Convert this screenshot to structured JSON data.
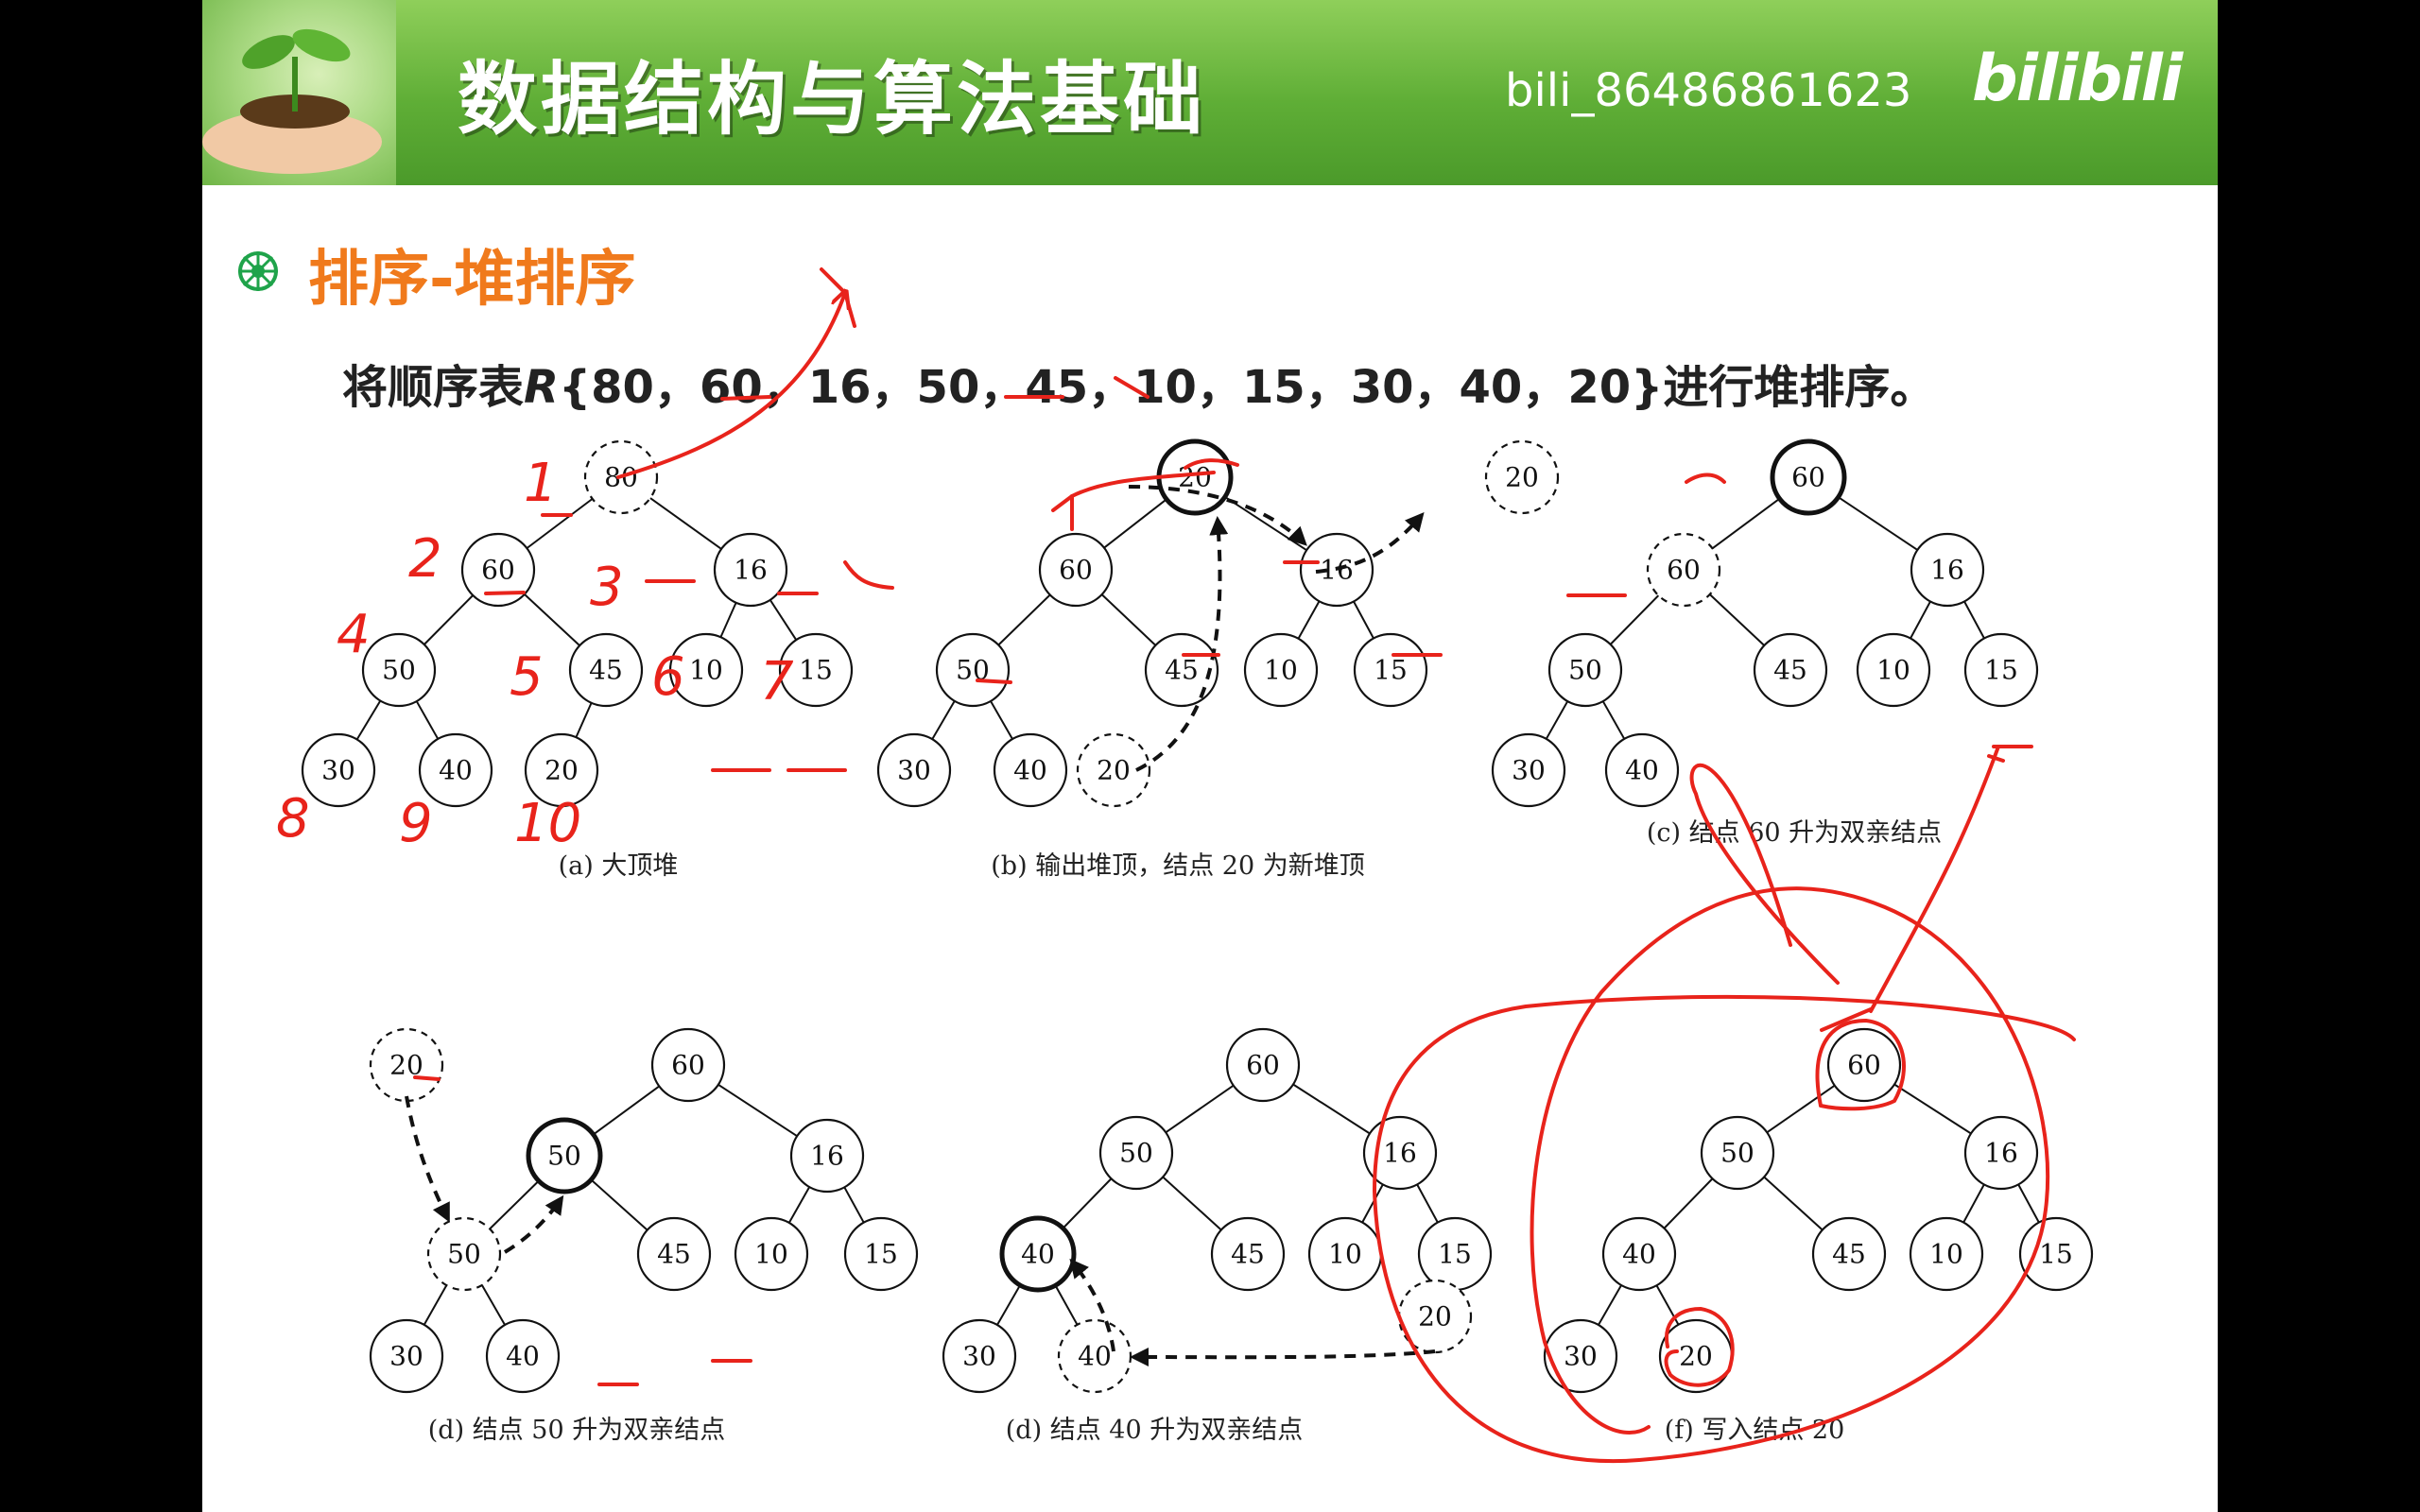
{
  "banner": {
    "title": "数据结构与算法基础",
    "user": "bili_86486861623",
    "logo": "bilibili"
  },
  "heading": "排序-堆排序",
  "statement": {
    "prefix": "将顺序表",
    "r": "R",
    "seq": "{80，60，16，50，45，10，15，30，40，20}",
    "suffix": "进行堆排序。"
  },
  "panels": [
    {
      "caption": "(a)  大顶堆",
      "nodes": [
        {
          "v": "80",
          "s": "dashed"
        },
        {
          "v": "60"
        },
        {
          "v": "16"
        },
        {
          "v": "50"
        },
        {
          "v": "45"
        },
        {
          "v": "10"
        },
        {
          "v": "15"
        },
        {
          "v": "30"
        },
        {
          "v": "40"
        },
        {
          "v": "20"
        }
      ]
    },
    {
      "caption": "(b)  输出堆顶，结点 20 为新堆顶",
      "nodes": [
        {
          "v": "20",
          "s": "bold"
        },
        {
          "v": "60"
        },
        {
          "v": "16"
        },
        {
          "v": "50"
        },
        {
          "v": "45"
        },
        {
          "v": "10"
        },
        {
          "v": "15"
        },
        {
          "v": "30"
        },
        {
          "v": "40"
        },
        {
          "v": "20",
          "s": "dashed"
        }
      ]
    },
    {
      "caption": "(c)  结点 60 升为双亲结点",
      "nodes": [
        {
          "v": "60",
          "s": "bold"
        },
        {
          "v": "60",
          "s": "dashed"
        },
        {
          "v": "16"
        },
        {
          "v": "50"
        },
        {
          "v": "45"
        },
        {
          "v": "10"
        },
        {
          "v": "15"
        },
        {
          "v": "30"
        },
        {
          "v": "40"
        },
        {
          "v": "20",
          "s": "dashed"
        }
      ]
    },
    {
      "caption": "(d)  结点 50 升为双亲结点",
      "nodes": [
        {
          "v": "60"
        },
        {
          "v": "50",
          "s": "bold"
        },
        {
          "v": "16"
        },
        {
          "v": "50",
          "s": "dashed"
        },
        {
          "v": "45"
        },
        {
          "v": "10"
        },
        {
          "v": "15"
        },
        {
          "v": "30"
        },
        {
          "v": "40"
        },
        {
          "v": "20",
          "s": "dashed"
        }
      ]
    },
    {
      "caption": "(d)  结点 40 升为双亲结点",
      "nodes": [
        {
          "v": "60"
        },
        {
          "v": "50"
        },
        {
          "v": "16"
        },
        {
          "v": "40",
          "s": "bold"
        },
        {
          "v": "45"
        },
        {
          "v": "10"
        },
        {
          "v": "15"
        },
        {
          "v": "30"
        },
        {
          "v": "40",
          "s": "dashed"
        },
        {
          "v": "20",
          "s": "dashed"
        }
      ]
    },
    {
      "caption": "(f)  写入结点 20",
      "nodes": [
        {
          "v": "60"
        },
        {
          "v": "50"
        },
        {
          "v": "16"
        },
        {
          "v": "40"
        },
        {
          "v": "45"
        },
        {
          "v": "10"
        },
        {
          "v": "15"
        },
        {
          "v": "30"
        },
        {
          "v": "20"
        }
      ]
    }
  ],
  "annotations": [
    "1",
    "2",
    "3",
    "4",
    "5",
    "6",
    "7",
    "8",
    "9",
    "10"
  ],
  "colors": {
    "banner": "#5fae36",
    "heading": "#f07a1c",
    "ink": "#e8231b"
  }
}
